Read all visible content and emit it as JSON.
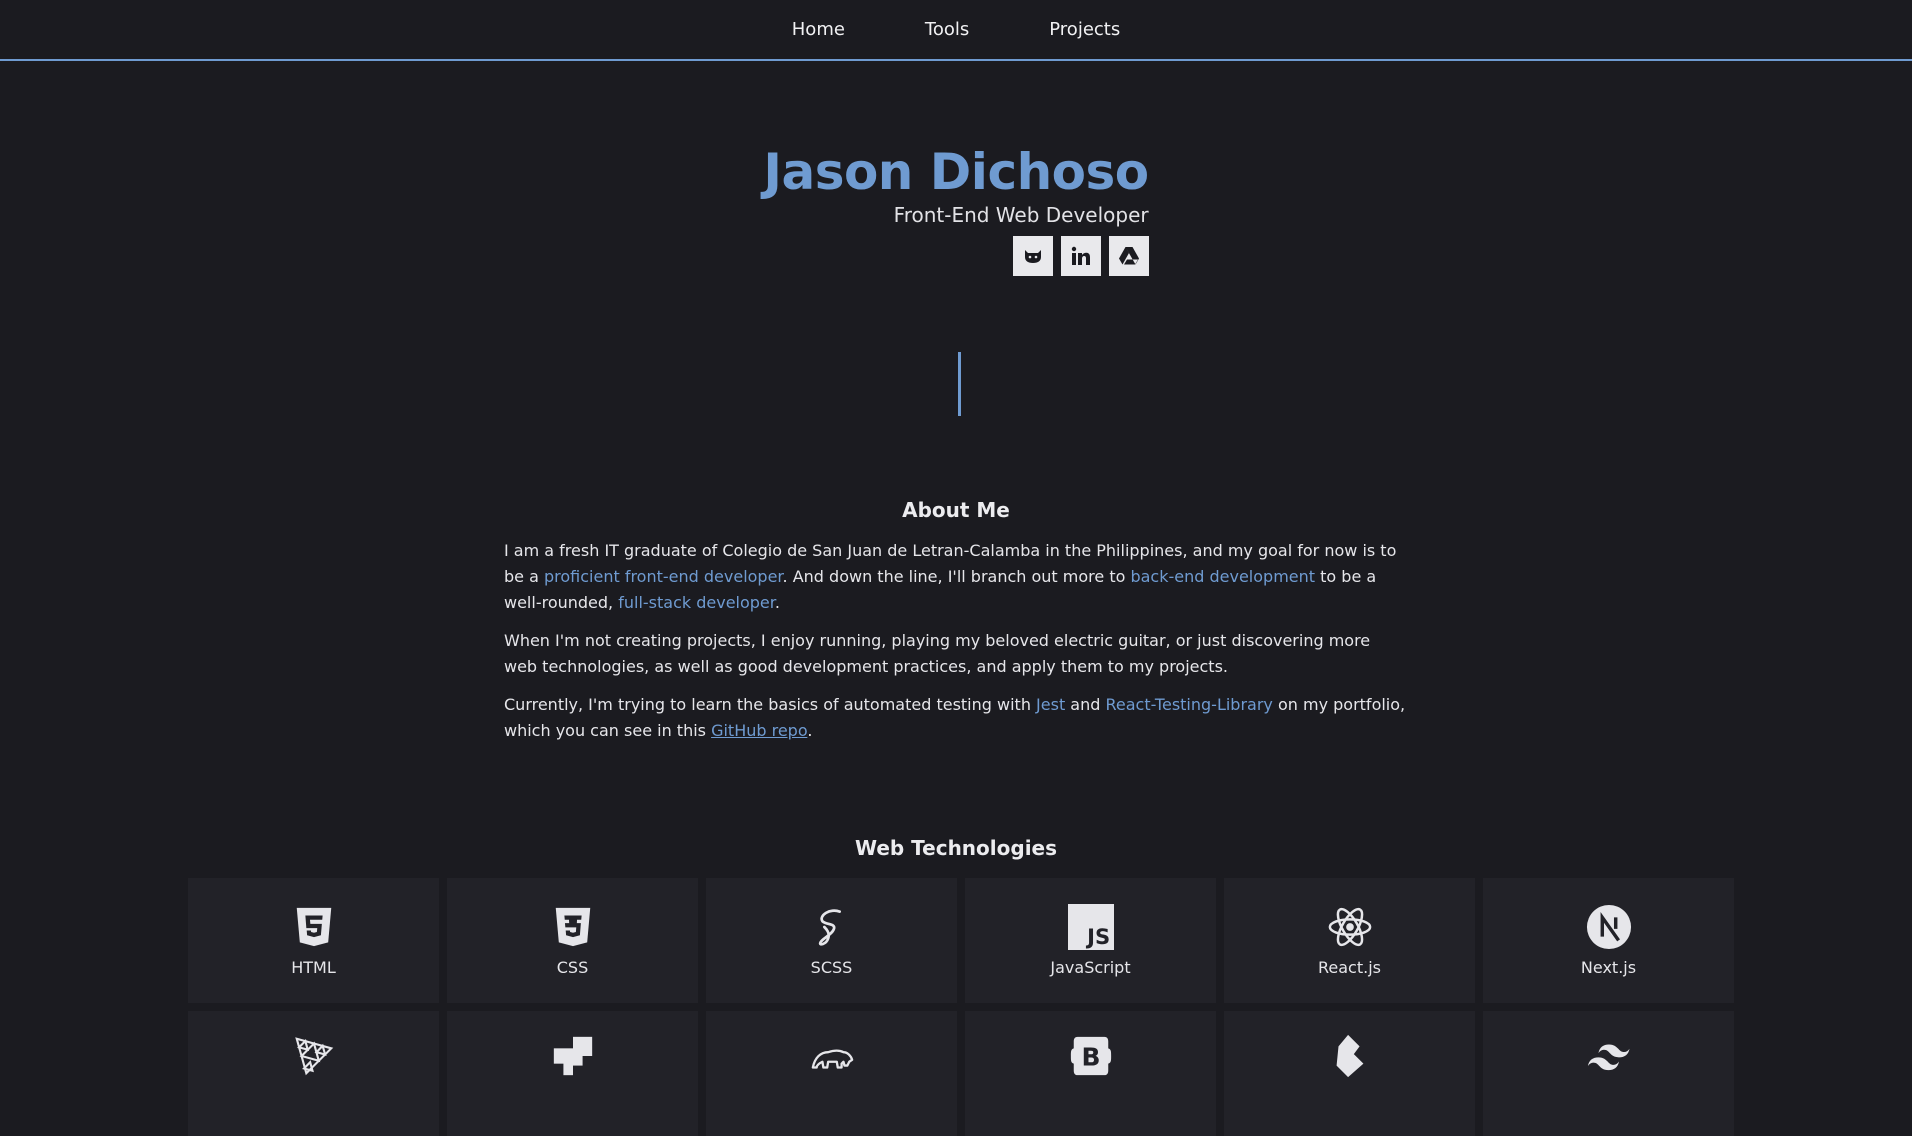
{
  "nav": {
    "items": [
      {
        "label": "Home"
      },
      {
        "label": "Tools"
      },
      {
        "label": "Projects"
      }
    ]
  },
  "hero": {
    "name": "Jason Dichoso",
    "role": "Front-End Web Developer",
    "socials": [
      {
        "icon": "github-icon"
      },
      {
        "icon": "linkedin-icon"
      },
      {
        "icon": "google-drive-icon"
      }
    ]
  },
  "about": {
    "title": "About Me",
    "p1": {
      "a": "I am a fresh IT graduate of Colegio de San Juan de Letran-Calamba in the Philippines, and my goal for now is to be a ",
      "b": "proficient front-end developer",
      "c": ". And down the line, I'll branch out more to ",
      "d": "back-end development",
      "e": " to be a well-rounded, ",
      "f": "full-stack developer",
      "g": "."
    },
    "p2": "When I'm not creating projects, I enjoy running, playing my beloved electric guitar, or just discovering more web technologies, as well as good development practices, and apply them to my projects.",
    "p3": {
      "a": "Currently, I'm trying to learn the basics of automated testing with ",
      "b": "Jest",
      "c": " and ",
      "d": "React-Testing-Library",
      "e": " on my portfolio, which you can see in this ",
      "f": "GitHub repo",
      "g": "."
    }
  },
  "tech": {
    "title": "Web Technologies",
    "items": [
      {
        "label": "HTML",
        "icon": "html5-icon"
      },
      {
        "label": "CSS",
        "icon": "css3-icon"
      },
      {
        "label": "SCSS",
        "icon": "sass-icon"
      },
      {
        "label": "JavaScript",
        "icon": "javascript-icon"
      },
      {
        "label": "React.js",
        "icon": "react-icon"
      },
      {
        "label": "Next.js",
        "icon": "nextjs-icon"
      },
      {
        "icon": "threejs-icon"
      },
      {
        "icon": "framer-icon"
      },
      {
        "icon": "bear-icon"
      },
      {
        "icon": "bootstrap-icon"
      },
      {
        "icon": "bulma-icon"
      },
      {
        "icon": "tailwind-icon"
      }
    ]
  },
  "colors": {
    "background": "#1b1b20",
    "accent": "#6f9bd1",
    "card": "#222228"
  }
}
